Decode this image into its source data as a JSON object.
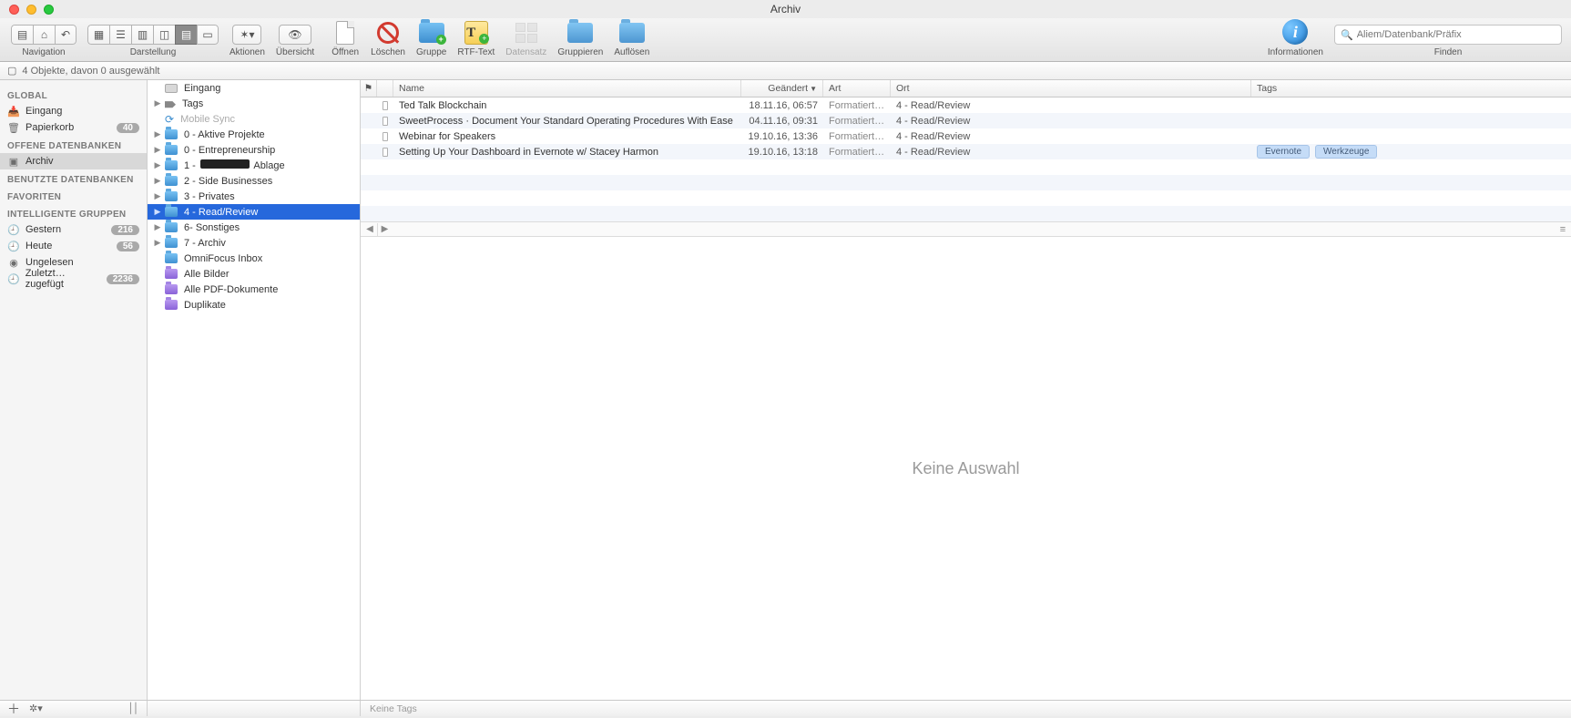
{
  "window": {
    "title": "Archiv"
  },
  "toolbar": {
    "nav_label": "Navigation",
    "view_label": "Darstellung",
    "actions_label": "Aktionen",
    "overview_label": "Übersicht",
    "open_label": "Öffnen",
    "delete_label": "Löschen",
    "group_label": "Gruppe",
    "rtf_label": "RTF-Text",
    "record_label": "Datensatz",
    "groupby_label": "Gruppieren",
    "ungroup_label": "Auflösen",
    "info_label": "Informationen",
    "search_label": "Finden",
    "search_placeholder": "Aliem/Datenbank/Präfix"
  },
  "infobar": {
    "text": "4 Objekte, davon 0 ausgewählt"
  },
  "sidebar": {
    "sections": [
      {
        "header": "GLOBAL",
        "items": [
          {
            "icon": "inbox",
            "label": "Eingang"
          },
          {
            "icon": "trash",
            "label": "Papierkorb",
            "count": "40"
          }
        ]
      },
      {
        "header": "OFFENE DATENBANKEN",
        "items": [
          {
            "icon": "db",
            "label": "Archiv",
            "selected": true
          }
        ]
      },
      {
        "header": "BENUTZTE DATENBANKEN",
        "items": []
      },
      {
        "header": "FAVORITEN",
        "items": []
      },
      {
        "header": "INTELLIGENTE GRUPPEN",
        "items": [
          {
            "icon": "clock",
            "label": "Gestern",
            "count": "216"
          },
          {
            "icon": "clock",
            "label": "Heute",
            "count": "56"
          },
          {
            "icon": "dot",
            "label": "Ungelesen"
          },
          {
            "icon": "clock",
            "label": "Zuletzt…zugefügt",
            "count": "2236"
          }
        ]
      }
    ]
  },
  "tree": [
    {
      "icon": "inbox",
      "label": "Eingang"
    },
    {
      "icon": "tag",
      "label": "Tags",
      "disclose": true
    },
    {
      "icon": "sync",
      "label": "Mobile Sync",
      "disabled": true
    },
    {
      "icon": "folder",
      "label": "0 - Aktive Projekte",
      "disclose": true
    },
    {
      "icon": "folder",
      "label": "0 - Entrepreneurship",
      "disclose": true
    },
    {
      "icon": "folder",
      "label_prefix": "1 - ",
      "redact": true,
      "label_suffix": " Ablage",
      "disclose": true
    },
    {
      "icon": "folder",
      "label": "2 - Side Businesses",
      "disclose": true
    },
    {
      "icon": "folder",
      "label": "3 - Privates",
      "disclose": true
    },
    {
      "icon": "folder",
      "label": "4 - Read/Review",
      "disclose": true,
      "selected": true
    },
    {
      "icon": "folder",
      "label": "6- Sonstiges",
      "disclose": true
    },
    {
      "icon": "folder",
      "label": "7 - Archiv",
      "disclose": true
    },
    {
      "icon": "folder",
      "label": "OmniFocus Inbox"
    },
    {
      "icon": "smart",
      "label": "Alle Bilder"
    },
    {
      "icon": "smart",
      "label": "Alle PDF-Dokumente"
    },
    {
      "icon": "smart",
      "label": "Duplikate"
    }
  ],
  "columns": {
    "flag": "⚑",
    "name": "Name",
    "date": "Geändert",
    "sort_arrow": "▼",
    "kind": "Art",
    "loc": "Ort",
    "tags": "Tags"
  },
  "rows": [
    {
      "name": "Ted Talk Blockchain",
      "date": "18.11.16, 06:57",
      "kind": "Formatierte…",
      "loc": "4 - Read/Review",
      "tags": []
    },
    {
      "name": "SweetProcess · Document Your Standard Operating Procedures With Ease",
      "date": "04.11.16, 09:31",
      "kind": "Formatierte…",
      "loc": "4 - Read/Review",
      "tags": []
    },
    {
      "name": "Webinar for Speakers",
      "date": "19.10.16, 13:36",
      "kind": "Formatierte…",
      "loc": "4 - Read/Review",
      "tags": []
    },
    {
      "name": "Setting Up Your Dashboard in Evernote w/ Stacey Harmon",
      "date": "19.10.16, 13:18",
      "kind": "Formatierte…",
      "loc": "4 - Read/Review",
      "tags": [
        "Evernote",
        "Werkzeuge"
      ]
    }
  ],
  "preview": {
    "empty_text": "Keine Auswahl"
  },
  "bottom": {
    "tags_placeholder": "Keine Tags"
  }
}
